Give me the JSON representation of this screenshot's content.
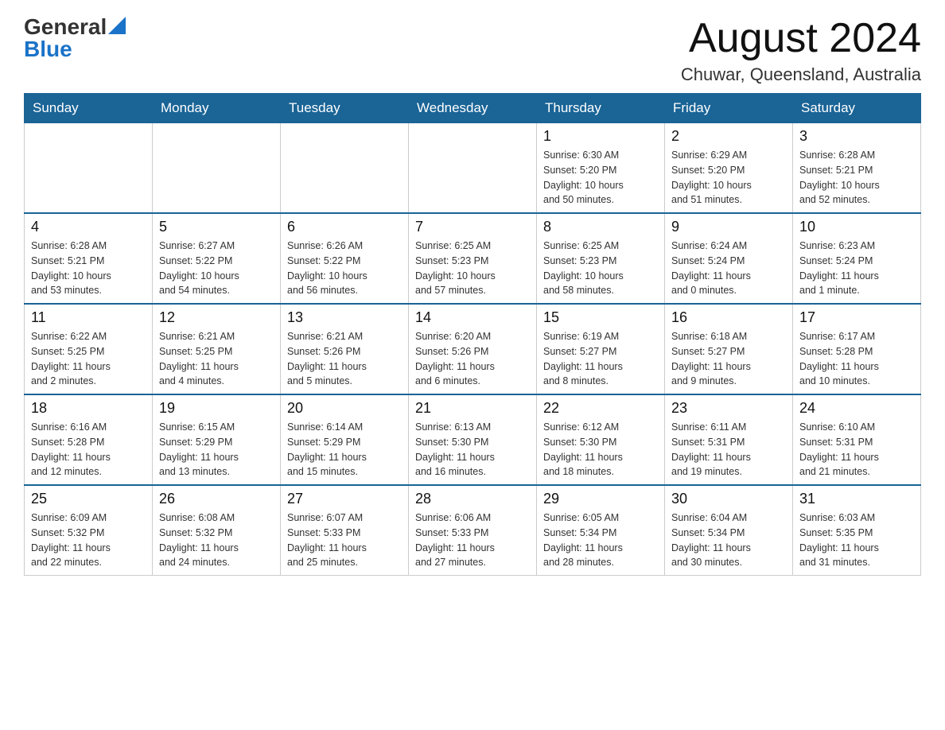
{
  "header": {
    "logo_general": "General",
    "logo_blue": "Blue",
    "month_year": "August 2024",
    "location": "Chuwar, Queensland, Australia"
  },
  "days_of_week": [
    "Sunday",
    "Monday",
    "Tuesday",
    "Wednesday",
    "Thursday",
    "Friday",
    "Saturday"
  ],
  "weeks": [
    [
      {
        "day": "",
        "info": ""
      },
      {
        "day": "",
        "info": ""
      },
      {
        "day": "",
        "info": ""
      },
      {
        "day": "",
        "info": ""
      },
      {
        "day": "1",
        "info": "Sunrise: 6:30 AM\nSunset: 5:20 PM\nDaylight: 10 hours\nand 50 minutes."
      },
      {
        "day": "2",
        "info": "Sunrise: 6:29 AM\nSunset: 5:20 PM\nDaylight: 10 hours\nand 51 minutes."
      },
      {
        "day": "3",
        "info": "Sunrise: 6:28 AM\nSunset: 5:21 PM\nDaylight: 10 hours\nand 52 minutes."
      }
    ],
    [
      {
        "day": "4",
        "info": "Sunrise: 6:28 AM\nSunset: 5:21 PM\nDaylight: 10 hours\nand 53 minutes."
      },
      {
        "day": "5",
        "info": "Sunrise: 6:27 AM\nSunset: 5:22 PM\nDaylight: 10 hours\nand 54 minutes."
      },
      {
        "day": "6",
        "info": "Sunrise: 6:26 AM\nSunset: 5:22 PM\nDaylight: 10 hours\nand 56 minutes."
      },
      {
        "day": "7",
        "info": "Sunrise: 6:25 AM\nSunset: 5:23 PM\nDaylight: 10 hours\nand 57 minutes."
      },
      {
        "day": "8",
        "info": "Sunrise: 6:25 AM\nSunset: 5:23 PM\nDaylight: 10 hours\nand 58 minutes."
      },
      {
        "day": "9",
        "info": "Sunrise: 6:24 AM\nSunset: 5:24 PM\nDaylight: 11 hours\nand 0 minutes."
      },
      {
        "day": "10",
        "info": "Sunrise: 6:23 AM\nSunset: 5:24 PM\nDaylight: 11 hours\nand 1 minute."
      }
    ],
    [
      {
        "day": "11",
        "info": "Sunrise: 6:22 AM\nSunset: 5:25 PM\nDaylight: 11 hours\nand 2 minutes."
      },
      {
        "day": "12",
        "info": "Sunrise: 6:21 AM\nSunset: 5:25 PM\nDaylight: 11 hours\nand 4 minutes."
      },
      {
        "day": "13",
        "info": "Sunrise: 6:21 AM\nSunset: 5:26 PM\nDaylight: 11 hours\nand 5 minutes."
      },
      {
        "day": "14",
        "info": "Sunrise: 6:20 AM\nSunset: 5:26 PM\nDaylight: 11 hours\nand 6 minutes."
      },
      {
        "day": "15",
        "info": "Sunrise: 6:19 AM\nSunset: 5:27 PM\nDaylight: 11 hours\nand 8 minutes."
      },
      {
        "day": "16",
        "info": "Sunrise: 6:18 AM\nSunset: 5:27 PM\nDaylight: 11 hours\nand 9 minutes."
      },
      {
        "day": "17",
        "info": "Sunrise: 6:17 AM\nSunset: 5:28 PM\nDaylight: 11 hours\nand 10 minutes."
      }
    ],
    [
      {
        "day": "18",
        "info": "Sunrise: 6:16 AM\nSunset: 5:28 PM\nDaylight: 11 hours\nand 12 minutes."
      },
      {
        "day": "19",
        "info": "Sunrise: 6:15 AM\nSunset: 5:29 PM\nDaylight: 11 hours\nand 13 minutes."
      },
      {
        "day": "20",
        "info": "Sunrise: 6:14 AM\nSunset: 5:29 PM\nDaylight: 11 hours\nand 15 minutes."
      },
      {
        "day": "21",
        "info": "Sunrise: 6:13 AM\nSunset: 5:30 PM\nDaylight: 11 hours\nand 16 minutes."
      },
      {
        "day": "22",
        "info": "Sunrise: 6:12 AM\nSunset: 5:30 PM\nDaylight: 11 hours\nand 18 minutes."
      },
      {
        "day": "23",
        "info": "Sunrise: 6:11 AM\nSunset: 5:31 PM\nDaylight: 11 hours\nand 19 minutes."
      },
      {
        "day": "24",
        "info": "Sunrise: 6:10 AM\nSunset: 5:31 PM\nDaylight: 11 hours\nand 21 minutes."
      }
    ],
    [
      {
        "day": "25",
        "info": "Sunrise: 6:09 AM\nSunset: 5:32 PM\nDaylight: 11 hours\nand 22 minutes."
      },
      {
        "day": "26",
        "info": "Sunrise: 6:08 AM\nSunset: 5:32 PM\nDaylight: 11 hours\nand 24 minutes."
      },
      {
        "day": "27",
        "info": "Sunrise: 6:07 AM\nSunset: 5:33 PM\nDaylight: 11 hours\nand 25 minutes."
      },
      {
        "day": "28",
        "info": "Sunrise: 6:06 AM\nSunset: 5:33 PM\nDaylight: 11 hours\nand 27 minutes."
      },
      {
        "day": "29",
        "info": "Sunrise: 6:05 AM\nSunset: 5:34 PM\nDaylight: 11 hours\nand 28 minutes."
      },
      {
        "day": "30",
        "info": "Sunrise: 6:04 AM\nSunset: 5:34 PM\nDaylight: 11 hours\nand 30 minutes."
      },
      {
        "day": "31",
        "info": "Sunrise: 6:03 AM\nSunset: 5:35 PM\nDaylight: 11 hours\nand 31 minutes."
      }
    ]
  ]
}
